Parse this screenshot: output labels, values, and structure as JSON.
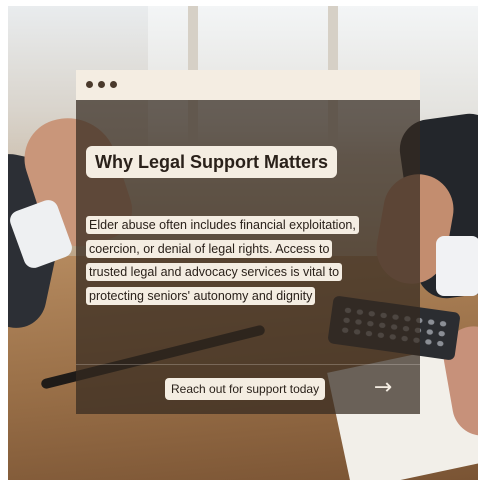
{
  "card": {
    "heading": "Why Legal Support Matters",
    "body_lines": [
      "Elder abuse often includes financial exploitation,",
      "coercion, or denial of legal rights. Access to",
      "trusted legal and advocacy services is vital to",
      "protecting seniors' autonomy and dignity"
    ],
    "cta_label": "Reach out for support today",
    "arrow_icon": "arrow-right-icon",
    "arrow_glyph": "→",
    "window_dots_icon": "three-dots-icon"
  },
  "colors": {
    "card_overlay": "#342a20",
    "highlight": "#f4ede2",
    "text_dark": "#2a211a"
  }
}
